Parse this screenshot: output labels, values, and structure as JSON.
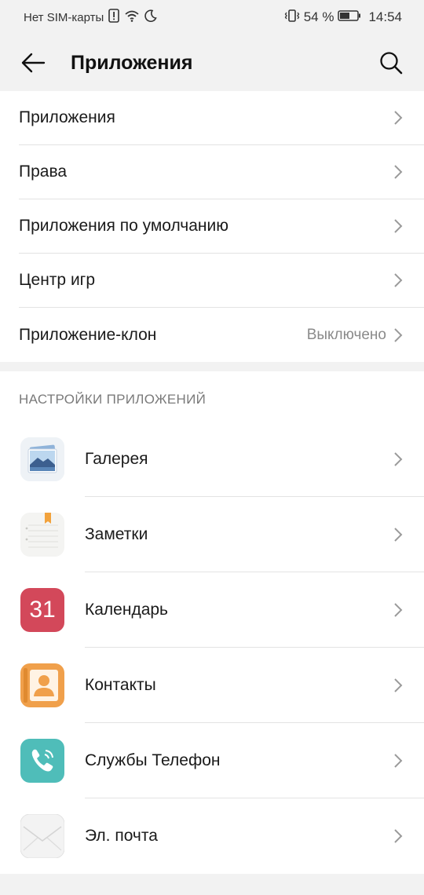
{
  "status": {
    "carrier": "Нет SIM-карты",
    "battery": "54 %",
    "time": "14:54"
  },
  "appbar": {
    "title": "Приложения",
    "back_icon": "back-arrow-icon",
    "search_icon": "search-icon"
  },
  "menu": [
    {
      "label": "Приложения",
      "value": ""
    },
    {
      "label": "Права",
      "value": ""
    },
    {
      "label": "Приложения по умолчанию",
      "value": ""
    },
    {
      "label": "Центр игр",
      "value": ""
    },
    {
      "label": "Приложение-клон",
      "value": "Выключено"
    }
  ],
  "section_title": "НАСТРОЙКИ ПРИЛОЖЕНИЙ",
  "apps": [
    {
      "label": "Галерея",
      "icon": "gallery-icon"
    },
    {
      "label": "Заметки",
      "icon": "notes-icon"
    },
    {
      "label": "Календарь",
      "icon": "calendar-icon",
      "icon_text": "31"
    },
    {
      "label": "Контакты",
      "icon": "contacts-icon"
    },
    {
      "label": "Службы Телефон",
      "icon": "phone-icon"
    },
    {
      "label": "Эл. почта",
      "icon": "email-icon"
    }
  ],
  "colors": {
    "calendar": "#d3485a",
    "contacts": "#f0a04b",
    "phone": "#4fbdb9",
    "accent": "#1a1a1a"
  }
}
